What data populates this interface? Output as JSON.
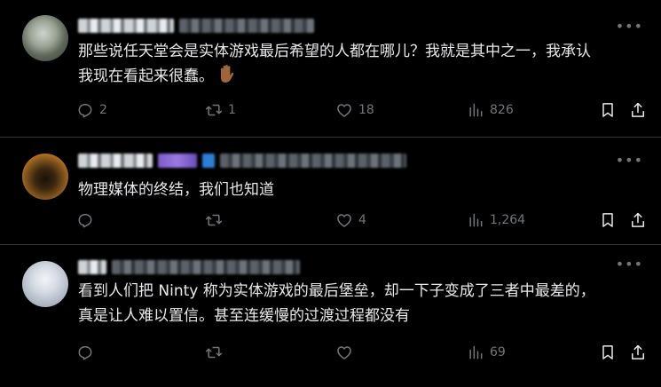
{
  "posts": [
    {
      "text_line1": "那些说任天堂会是实体游戏最后希望的人都在哪儿？我就是其中之一，我承认",
      "text_line2": "我现在看起来很蠢。",
      "emoji": "raised-hand-emoji",
      "stats": {
        "replies": "2",
        "reposts": "1",
        "likes": "18",
        "views": "826"
      }
    },
    {
      "text_line1": "物理媒体的终结，我们也知道",
      "text_line2": "",
      "stats": {
        "replies": "",
        "reposts": "",
        "likes": "4",
        "views": "1,264"
      }
    },
    {
      "text_line1": "看到人们把 Ninty 称为实体游戏的最后堡垒，却一下子变成了三者中最差的，",
      "text_line2": "真是让人难以置信。甚至连缓慢的过渡过程都没有",
      "stats": {
        "replies": "",
        "reposts": "",
        "likes": "",
        "views": "69"
      }
    }
  ],
  "colors": {
    "background": "#000000",
    "text": "#e7e9ea",
    "muted": "#71767b",
    "divider": "#2f3336"
  },
  "icons": [
    "reply-icon",
    "repost-icon",
    "like-icon",
    "views-icon",
    "bookmark-icon",
    "share-icon",
    "more-icon"
  ]
}
